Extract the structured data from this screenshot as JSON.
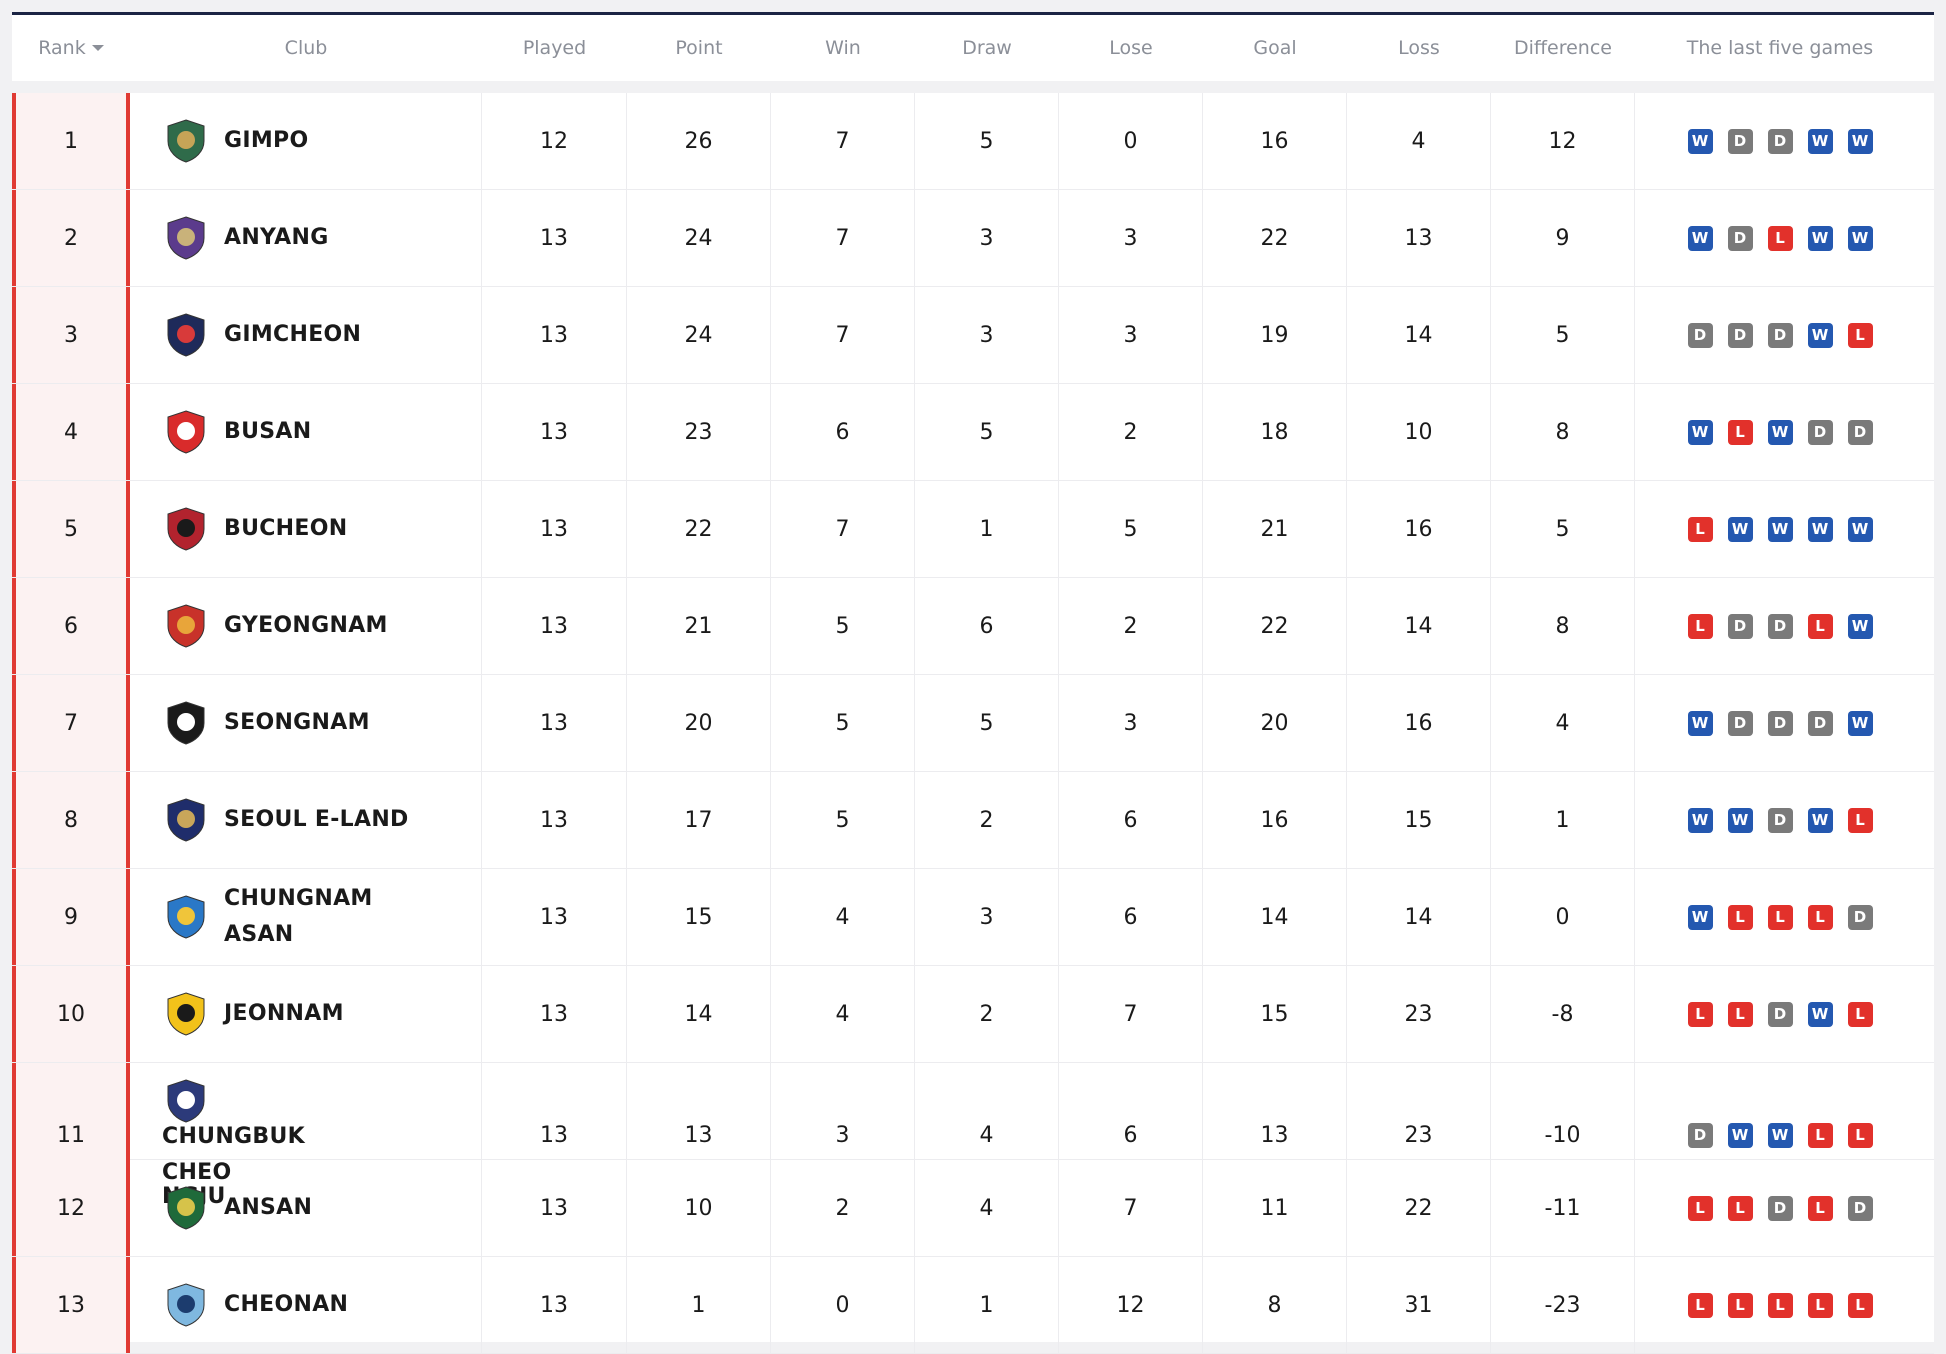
{
  "header": {
    "rank": "Rank",
    "club": "Club",
    "played": "Played",
    "point": "Point",
    "win": "Win",
    "draw": "Draw",
    "lose": "Lose",
    "goal": "Goal",
    "loss": "Loss",
    "difference": "Difference",
    "last_five": "The last five games"
  },
  "colors": {
    "win": "#2458b0",
    "draw": "#7a7a7a",
    "lose": "#e2312b",
    "rank_accent": "#e03a33"
  },
  "rows": [
    {
      "rank": "1",
      "club": "GIMPO",
      "played": "12",
      "point": "26",
      "win": "7",
      "draw": "5",
      "lose": "0",
      "goal": "16",
      "loss": "4",
      "difference": "12",
      "form": [
        "W",
        "D",
        "D",
        "W",
        "W"
      ],
      "crest": [
        "#2f6b4a",
        "#c6a457"
      ]
    },
    {
      "rank": "2",
      "club": "ANYANG",
      "played": "13",
      "point": "24",
      "win": "7",
      "draw": "3",
      "lose": "3",
      "goal": "22",
      "loss": "13",
      "difference": "9",
      "form": [
        "W",
        "D",
        "L",
        "W",
        "W"
      ],
      "crest": [
        "#5b3b8c",
        "#c9b27a"
      ]
    },
    {
      "rank": "3",
      "club": "GIMCHEON",
      "played": "13",
      "point": "24",
      "win": "7",
      "draw": "3",
      "lose": "3",
      "goal": "19",
      "loss": "14",
      "difference": "5",
      "form": [
        "D",
        "D",
        "D",
        "W",
        "L"
      ],
      "crest": [
        "#1e2a5a",
        "#d83a3a"
      ]
    },
    {
      "rank": "4",
      "club": "BUSAN",
      "played": "13",
      "point": "23",
      "win": "6",
      "draw": "5",
      "lose": "2",
      "goal": "18",
      "loss": "10",
      "difference": "8",
      "form": [
        "W",
        "L",
        "W",
        "D",
        "D"
      ],
      "crest": [
        "#d92b2b",
        "#ffffff"
      ]
    },
    {
      "rank": "5",
      "club": "BUCHEON",
      "played": "13",
      "point": "22",
      "win": "7",
      "draw": "1",
      "lose": "5",
      "goal": "21",
      "loss": "16",
      "difference": "5",
      "form": [
        "L",
        "W",
        "W",
        "W",
        "W"
      ],
      "crest": [
        "#b2232e",
        "#1a1a1a"
      ]
    },
    {
      "rank": "6",
      "club": "GYEONGNAM",
      "played": "13",
      "point": "21",
      "win": "5",
      "draw": "6",
      "lose": "2",
      "goal": "22",
      "loss": "14",
      "difference": "8",
      "form": [
        "L",
        "D",
        "D",
        "L",
        "W"
      ],
      "crest": [
        "#c8322a",
        "#e8a53a"
      ]
    },
    {
      "rank": "7",
      "club": "SEONGNAM",
      "played": "13",
      "point": "20",
      "win": "5",
      "draw": "5",
      "lose": "3",
      "goal": "20",
      "loss": "16",
      "difference": "4",
      "form": [
        "W",
        "D",
        "D",
        "D",
        "W"
      ],
      "crest": [
        "#1a1a1a",
        "#ffffff"
      ]
    },
    {
      "rank": "8",
      "club": "SEOUL E-LAND",
      "played": "13",
      "point": "17",
      "win": "5",
      "draw": "2",
      "lose": "6",
      "goal": "16",
      "loss": "15",
      "difference": "1",
      "form": [
        "W",
        "W",
        "D",
        "W",
        "L"
      ],
      "crest": [
        "#1f2d6b",
        "#c9a65a"
      ]
    },
    {
      "rank": "9",
      "club": "CHUNGNAM ASAN",
      "played": "13",
      "point": "15",
      "win": "4",
      "draw": "3",
      "lose": "6",
      "goal": "14",
      "loss": "14",
      "difference": "0",
      "form": [
        "W",
        "L",
        "L",
        "L",
        "D"
      ],
      "crest": [
        "#2a78c7",
        "#f0c53a"
      ]
    },
    {
      "rank": "10",
      "club": "JEONNAM",
      "played": "13",
      "point": "14",
      "win": "4",
      "draw": "2",
      "lose": "7",
      "goal": "15",
      "loss": "23",
      "difference": "-8",
      "form": [
        "L",
        "L",
        "D",
        "W",
        "L"
      ],
      "crest": [
        "#f2c21a",
        "#1a1a1a"
      ]
    },
    {
      "rank": "11",
      "club": "CHUNGBUK CHEONGJU",
      "club_line1": "CHUNGBUK CHEO",
      "club_line2": "NGJU",
      "played": "13",
      "point": "13",
      "win": "3",
      "draw": "4",
      "lose": "6",
      "goal": "13",
      "loss": "23",
      "difference": "-10",
      "form": [
        "D",
        "W",
        "W",
        "L",
        "L"
      ],
      "crest": [
        "#2c3a7a",
        "#ffffff"
      ]
    },
    {
      "rank": "12",
      "club": "ANSAN",
      "played": "13",
      "point": "10",
      "win": "2",
      "draw": "4",
      "lose": "7",
      "goal": "11",
      "loss": "22",
      "difference": "-11",
      "form": [
        "L",
        "L",
        "D",
        "L",
        "D"
      ],
      "crest": [
        "#1f6a3a",
        "#d6c34a"
      ]
    },
    {
      "rank": "13",
      "club": "CHEONAN",
      "played": "13",
      "point": "1",
      "win": "0",
      "draw": "1",
      "lose": "12",
      "goal": "8",
      "loss": "31",
      "difference": "-23",
      "form": [
        "L",
        "L",
        "L",
        "L",
        "L"
      ],
      "crest": [
        "#7fb8e0",
        "#1c3c6e"
      ]
    }
  ]
}
